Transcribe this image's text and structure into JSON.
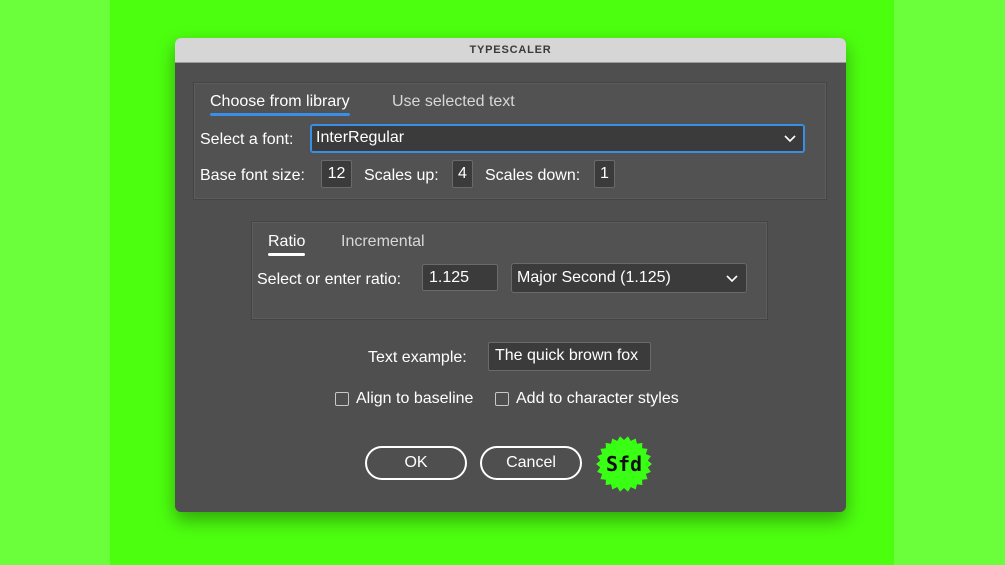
{
  "colors": {
    "outer_bg": "#6aff3a",
    "stage_bg": "#4cff0f",
    "accent": "#3a8ee6",
    "badge": "#39ff14"
  },
  "window": {
    "title": "TYPESCALER"
  },
  "font_tabs": {
    "active": "Choose from library",
    "inactive": "Use selected text"
  },
  "font": {
    "select_label": "Select a font:",
    "selected": "InterRegular",
    "base_size_label": "Base font size:",
    "base_size": "12",
    "scales_up_label": "Scales up:",
    "scales_up": "4",
    "scales_down_label": "Scales down:",
    "scales_down": "1"
  },
  "ratio_tabs": {
    "active": "Ratio",
    "inactive": "Incremental"
  },
  "ratio": {
    "label": "Select or enter ratio:",
    "value": "1.125",
    "preset": "Major Second (1.125)"
  },
  "example": {
    "label": "Text example:",
    "value": "The quick brown fox"
  },
  "options": {
    "align_baseline": "Align to baseline",
    "add_char_styles": "Add to character styles"
  },
  "buttons": {
    "ok": "OK",
    "cancel": "Cancel"
  },
  "badge": {
    "text": "Sfd",
    "icon": "starburst-logo-icon"
  }
}
